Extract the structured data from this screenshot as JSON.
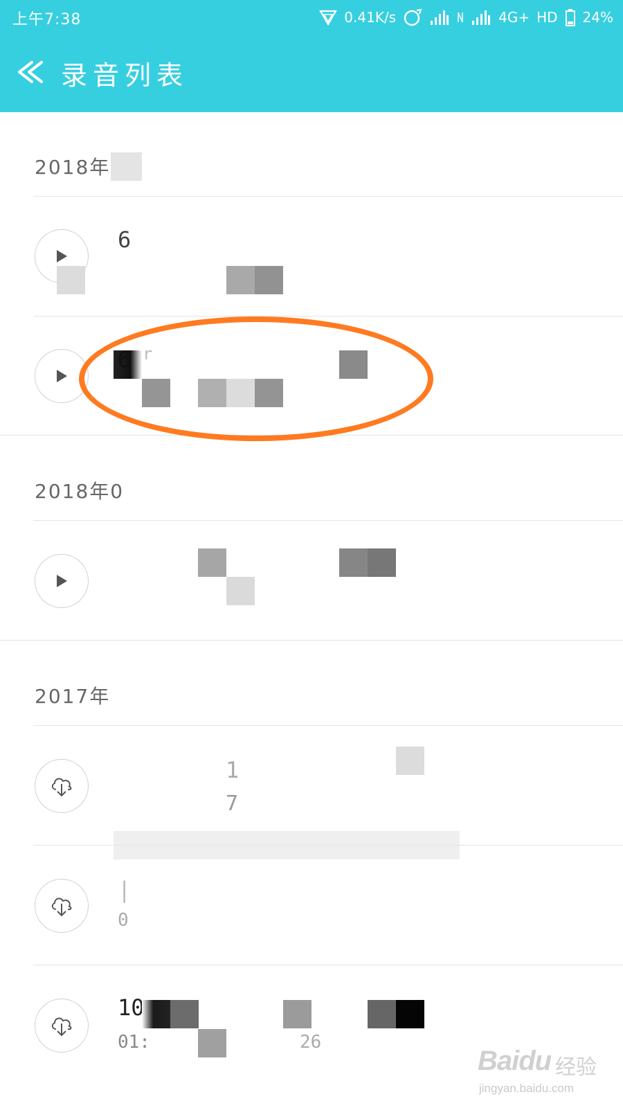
{
  "status_bar": {
    "time": "上午7:38",
    "net_speed": "0.41K/s",
    "network_type": "4G+",
    "hd_label": "HD",
    "battery": "24%"
  },
  "header": {
    "title": "录音列表",
    "back_icon": "double-chevron-left-icon"
  },
  "sections": [
    {
      "date": "2018年0",
      "recordings": [
        {
          "title": "6",
          "subtitle": "",
          "icon": "play-icon"
        },
        {
          "title": "6",
          "title_tail": "r",
          "subtitle": "",
          "icon": "play-icon",
          "highlighted": true
        }
      ]
    },
    {
      "date": "2018年0",
      "recordings": [
        {
          "title": "",
          "subtitle": "",
          "icon": "play-icon"
        }
      ]
    },
    {
      "date": "2017年",
      "recordings": [
        {
          "title": "1",
          "subtitle": "7",
          "icon": "cloud-download-icon"
        },
        {
          "title": "|",
          "subtitle": "0",
          "icon": "cloud-download-icon"
        },
        {
          "title": "10",
          "subtitle": "01:",
          "subtitle_tail": "26",
          "icon": "cloud-download-icon"
        }
      ]
    }
  ],
  "watermark": {
    "logo": "Baidu",
    "cn": "经验",
    "url": "jingyan.baidu.com"
  },
  "colors": {
    "header_bg": "#36cfe0",
    "highlight": "#ff7a20"
  }
}
